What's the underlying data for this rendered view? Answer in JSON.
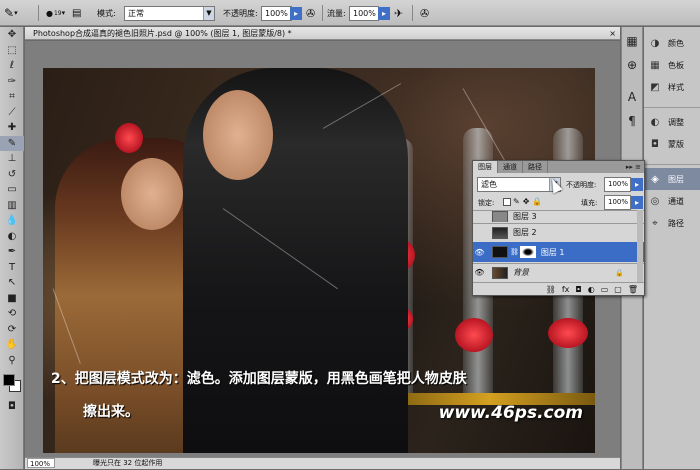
{
  "options_bar": {
    "brush_size": "19",
    "mode_label": "模式:",
    "mode_value": "正常",
    "opacity_label": "不透明度:",
    "opacity_value": "100%",
    "flow_label": "流量:",
    "flow_value": "100%"
  },
  "toolbox": {
    "tools": [
      "move-tool",
      "marquee-tool",
      "lasso-tool",
      "quick-select-tool",
      "crop-tool",
      "eyedropper-tool",
      "healing-tool",
      "brush-tool",
      "clone-stamp-tool",
      "history-brush-tool",
      "eraser-tool",
      "gradient-tool",
      "blur-tool",
      "dodge-tool",
      "pen-tool",
      "type-tool",
      "path-select-tool",
      "shape-tool",
      "3d-rotate-tool",
      "3d-orbit-tool",
      "hand-tool",
      "zoom-tool"
    ],
    "selected_tool": "brush-tool"
  },
  "document": {
    "tab_title": "Photoshop合成逼真的褪色旧照片.psd @ 100% (图层 1, 图层蒙版/8) *",
    "close_glyph": "×",
    "caption_line1": "2、把图层模式改为：滤色。添加图层蒙版，用黑色画笔把人物皮肤",
    "caption_line2": "擦出来。",
    "watermark": "www.46ps.com"
  },
  "status_bar": {
    "zoom": "100%",
    "info": "曝光只在 32 位起作用"
  },
  "dock": {
    "items": [
      {
        "label": "颜色",
        "icon": "color-swatch-icon"
      },
      {
        "label": "色板",
        "icon": "swatches-grid-icon"
      },
      {
        "label": "样式",
        "icon": "styles-icon"
      },
      {
        "label": "调整",
        "icon": "adjustments-icon"
      },
      {
        "label": "蒙版",
        "icon": "mask-icon"
      },
      {
        "label": "图层",
        "icon": "layers-stack-icon",
        "selected": true
      },
      {
        "label": "通道",
        "icon": "channels-icon"
      },
      {
        "label": "路径",
        "icon": "paths-icon"
      }
    ]
  },
  "layers_panel": {
    "tabs": [
      "图层",
      "通道",
      "路径"
    ],
    "active_tab": "图层",
    "blend_mode": "滤色",
    "opacity_label": "不透明度:",
    "opacity_value": "100%",
    "lock_label": "锁定:",
    "fill_label": "填充:",
    "fill_value": "100%",
    "layers": [
      {
        "name": "图层 3",
        "visible": false,
        "selected": false
      },
      {
        "name": "图层 2",
        "visible": false,
        "selected": false
      },
      {
        "name": "图层 1",
        "visible": true,
        "selected": true,
        "has_mask": true
      },
      {
        "name": "背景",
        "visible": true,
        "selected": false,
        "locked": true
      }
    ]
  },
  "colors": {
    "selection": "#3b6cc6",
    "foreground": "#000000",
    "background": "#ffffff"
  }
}
